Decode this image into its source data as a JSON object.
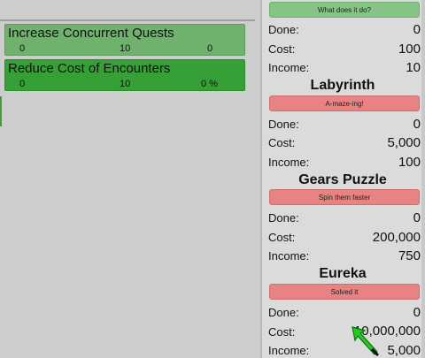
{
  "upgrades": [
    {
      "title": "Increase Concurrent Quests",
      "min": "0",
      "mid": "10",
      "current": "0"
    },
    {
      "title": "Reduce Cost of Encounters",
      "min": "0",
      "mid": "10",
      "current": "0 %"
    }
  ],
  "panel": {
    "first": {
      "button": "What does it do?",
      "done_label": "Done:",
      "done": "0",
      "cost_label": "Cost:",
      "cost": "100",
      "income_label": "Income:",
      "income": "10"
    },
    "items": [
      {
        "name": "Labyrinth",
        "button": "A-maze-ing!",
        "done_label": "Done:",
        "done": "0",
        "cost_label": "Cost:",
        "cost": "5,000",
        "income_label": "Income:",
        "income": "100"
      },
      {
        "name": "Gears Puzzle",
        "button": "Spin them faster",
        "done_label": "Done:",
        "done": "0",
        "cost_label": "Cost:",
        "cost": "200,000",
        "income_label": "Income:",
        "income": "750"
      },
      {
        "name": "Eureka",
        "button": "Solved it",
        "done_label": "Done:",
        "done": "0",
        "cost_label": "Cost:",
        "cost": "10,000,000",
        "income_label": "Income:",
        "income": "5,000"
      }
    ]
  },
  "cursor": {
    "icon": "green-arrow-cursor-icon",
    "color": "#22cc22"
  },
  "colors": {
    "button_green": "#86c485",
    "button_red": "#e88383",
    "upgrade_light": "#71b16e",
    "upgrade_dark": "#36a036"
  }
}
